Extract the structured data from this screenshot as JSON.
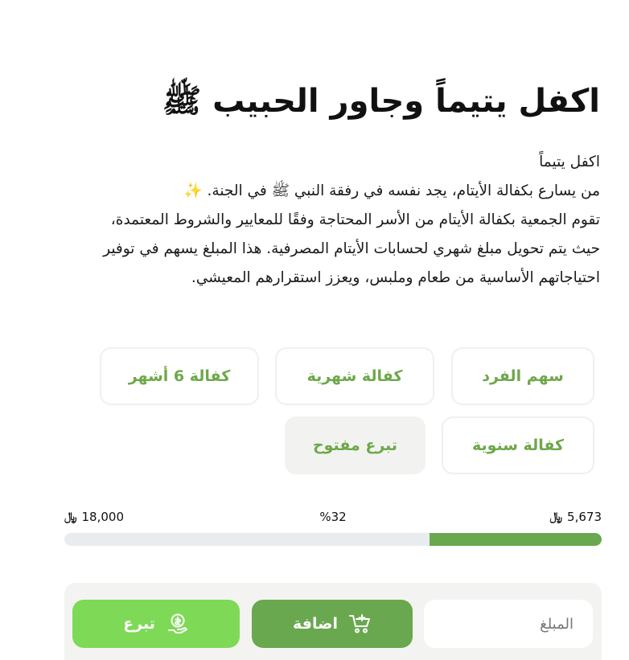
{
  "title": "اكفل يتيماً وجاور الحبيب ﷺ",
  "description": {
    "line1": "اكفل يتيماً",
    "line2": "من يسارع بكفالة الأيتام، يجد نفسه في رفقة النبي ﷺ في الجنة. ✨",
    "line3": "تقوم الجمعية بكفالة الأيتام من الأسر المحتاجة وفقًا للمعايير والشروط المعتمدة، حيث يتم تحويل مبلغ شهري لحسابات الأيتام المصرفية. هذا المبلغ يسهم في توفير احتياجاتهم الأساسية من طعام وملبس، ويعزز استقرارهم المعيشي."
  },
  "options": [
    {
      "label": "سهم الفرد"
    },
    {
      "label": "كفالة شهرية"
    },
    {
      "label": "كفالة 6 أشهر"
    },
    {
      "label": "كفالة سنوية"
    },
    {
      "label": "تبرع مفتوح",
      "selected": true
    }
  ],
  "progress": {
    "collected": "5,673",
    "target": "18,000",
    "percent_label": "%32",
    "percent": 32,
    "currency_symbol": "﷼"
  },
  "actions": {
    "amount_placeholder": "المبلغ",
    "add_label": "اضافة",
    "donate_label": "تبرع"
  },
  "colors": {
    "primary": "#6aa84f",
    "accent": "#7ed957",
    "track": "#e9ecef"
  },
  "icons": {
    "add": "cart-plus-icon",
    "donate": "coin-hand-icon"
  }
}
